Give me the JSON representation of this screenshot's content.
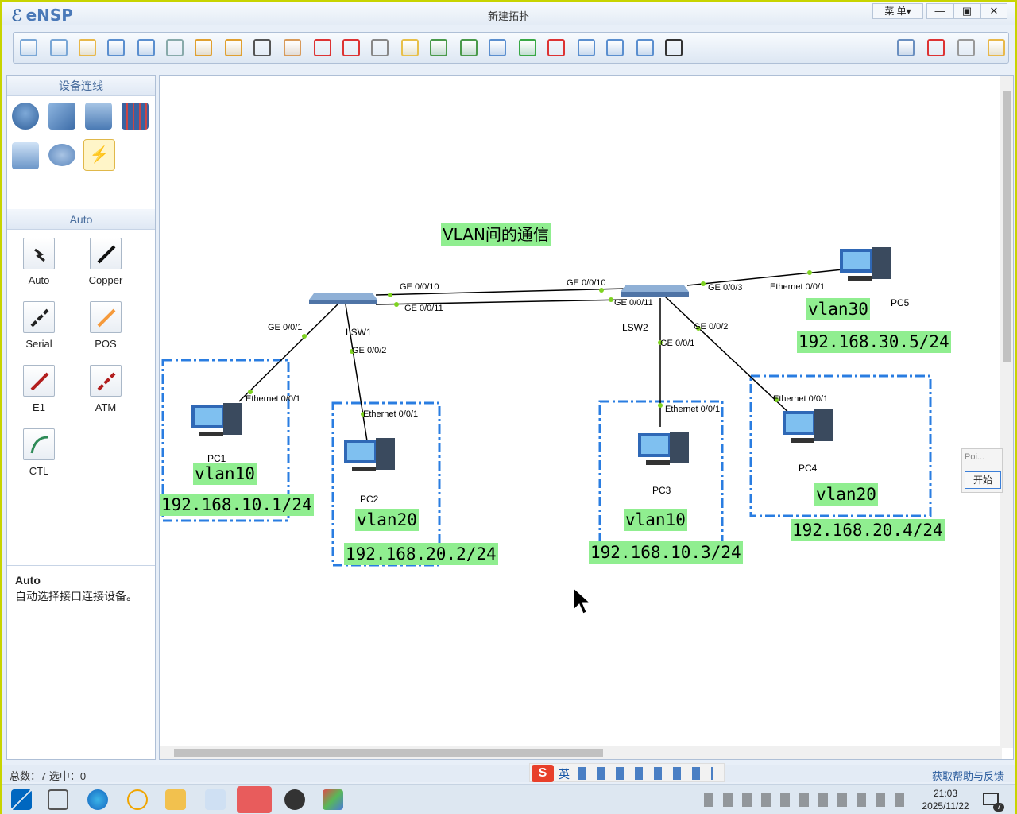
{
  "app": {
    "name": "eNSP",
    "window_title": "新建拓扑",
    "menu_label": "菜 单▾",
    "min_glyph": "—",
    "max_glyph": "▣",
    "close_glyph": "✕"
  },
  "toolbar_icons": [
    "new-topology-icon",
    "new-sample-icon",
    "open-icon",
    "save-icon",
    "save-as-icon",
    "print-icon",
    "undo-icon",
    "redo-icon",
    "select-icon",
    "pan-hand-icon",
    "delete-icon",
    "delete-link-icon",
    "text-icon",
    "rectangle-icon",
    "zoom-in-icon",
    "zoom-out-icon",
    "fit-view-icon",
    "start-device-icon",
    "stop-device-icon",
    "capture-icon",
    "topology-icon",
    "grid-icon",
    "cli-icon",
    "chat-icon",
    "huawei-icon",
    "settings-icon",
    "help-icon"
  ],
  "left_panel": {
    "devices_header": "设备连线",
    "devices": [
      "router-icon",
      "switch-icon",
      "wireless-icon",
      "firewall-icon",
      "pc-device-icon",
      "cloud-icon",
      "connection-icon"
    ],
    "cables_header": "Auto",
    "cables": [
      {
        "label": "Auto",
        "color": "#222222"
      },
      {
        "label": "Copper",
        "color": "#111111"
      },
      {
        "label": "Serial",
        "color": "#222222"
      },
      {
        "label": "POS",
        "color": "#f59a3c"
      },
      {
        "label": "E1",
        "color": "#b21e1e"
      },
      {
        "label": "ATM",
        "color": "#b21e1e"
      },
      {
        "label": "CTL",
        "color": "#2e8b57"
      }
    ],
    "desc_title": "Auto",
    "desc_text": "自动选择接口连接设备。"
  },
  "canvas": {
    "title": "VLAN间的通信",
    "switches": [
      {
        "name": "LSW1"
      },
      {
        "name": "LSW2"
      }
    ],
    "pcs": [
      {
        "name": "PC1"
      },
      {
        "name": "PC2"
      },
      {
        "name": "PC3"
      },
      {
        "name": "PC4"
      },
      {
        "name": "PC5"
      }
    ],
    "port_labels": [
      "GE 0/0/10",
      "GE 0/0/10",
      "GE 0/0/11",
      "GE 0/0/11",
      "GE 0/0/1",
      "GE 0/0/2",
      "GE 0/0/1",
      "GE 0/0/2",
      "GE 0/0/3",
      "Ethernet 0/0/1",
      "Ethernet 0/0/1",
      "Ethernet 0/0/1",
      "Ethernet 0/0/1",
      "Ethernet 0/0/1"
    ],
    "vlans": [
      "vlan10",
      "vlan20",
      "vlan10",
      "vlan20",
      "vlan30"
    ],
    "ips": [
      "192.168.10.1/24",
      "192.168.20.2/24",
      "192.168.10.3/24",
      "192.168.20.4/24",
      "192.168.30.5/24"
    ],
    "popup": {
      "title": "Poi...",
      "button": "开始"
    }
  },
  "status": {
    "left": "总数：7 选中：0",
    "right": "获取帮助与反馈"
  },
  "ime": {
    "mode": "英"
  },
  "taskbar": {
    "time": "21:03",
    "date": "2025/11/22",
    "notifications": "7"
  }
}
